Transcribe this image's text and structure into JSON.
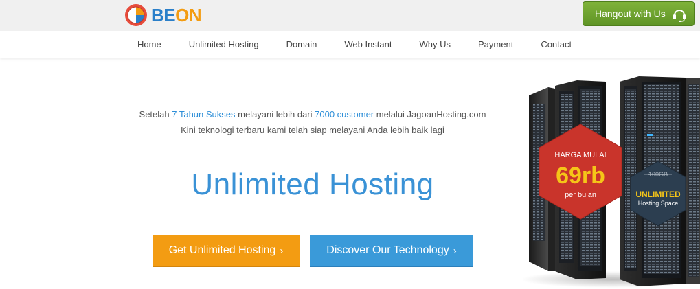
{
  "brand": {
    "logo_text_be": "BE",
    "logo_text_on": "ON"
  },
  "header": {
    "hangout_label": "Hangout with Us"
  },
  "nav": {
    "items": [
      {
        "label": "Home"
      },
      {
        "label": "Unlimited Hosting"
      },
      {
        "label": "Domain"
      },
      {
        "label": "Web Instant"
      },
      {
        "label": "Why Us"
      },
      {
        "label": "Payment"
      },
      {
        "label": "Contact"
      }
    ]
  },
  "hero": {
    "intro_1": "Setelah ",
    "intro_hl_1": "7 Tahun Sukses",
    "intro_2": " melayani lebih dari ",
    "intro_hl_2": "7000 customer",
    "intro_3": " melalui JagoanHosting.com Kini teknologi terbaru kami telah siap melayani Anda lebih baik lagi",
    "headline": "Unlimited Hosting",
    "primary_button": "Get Unlimited Hosting",
    "secondary_button": "Discover Our Technology",
    "chevron": "›"
  },
  "promo": {
    "price_label": "HARGA MULAI",
    "price": "69rb",
    "price_unit": "per bulan",
    "old_space": "100GB",
    "unlimited": "UNLIMITED",
    "space_label": "Hosting Space"
  },
  "colors": {
    "accent_blue": "#3a92d6",
    "orange": "#f39c12",
    "green": "#6aa52f",
    "price_badge_red": "#c9342b",
    "space_badge_navy": "#2c3e50",
    "price_yellow": "#f5c518"
  },
  "icons": [
    "logo-mark-icon",
    "headset-icon",
    "chevron-right-icon"
  ]
}
